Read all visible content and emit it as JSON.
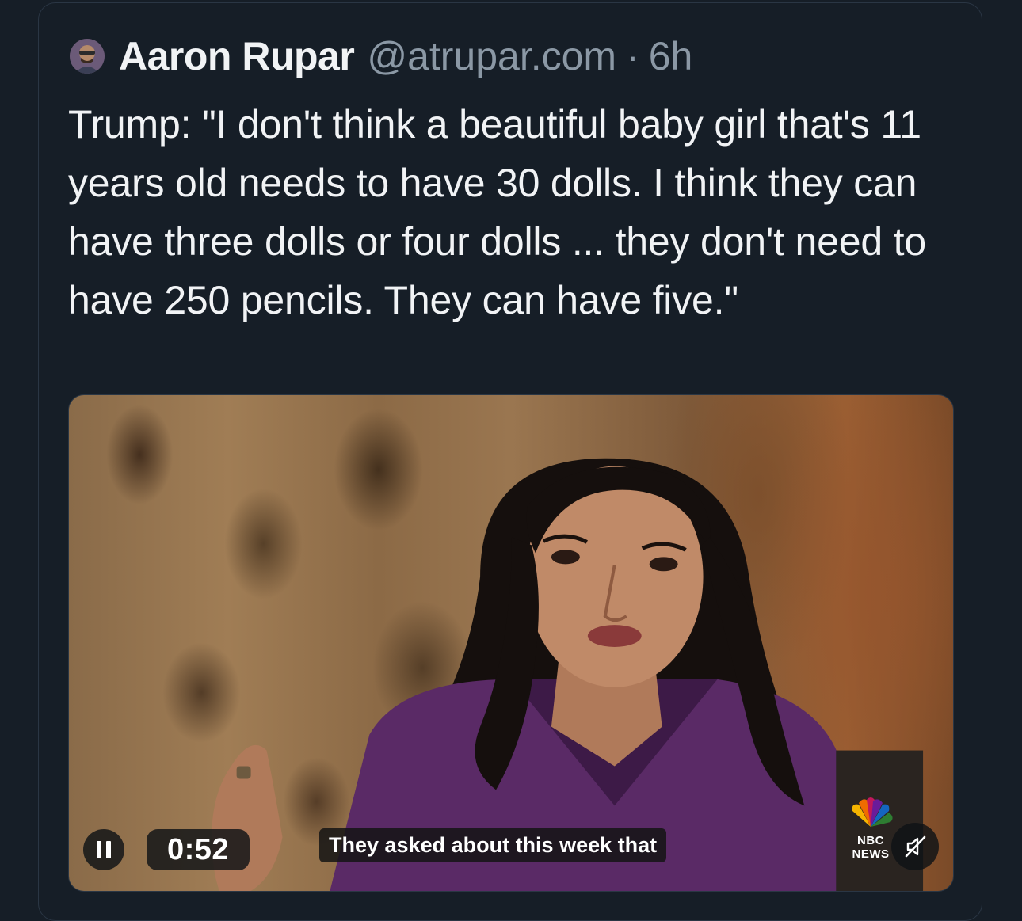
{
  "post": {
    "author_name": "Aaron Rupar",
    "handle": "@atrupar.com",
    "separator": "·",
    "timestamp": "6h",
    "text": "Trump: \"I don't think a beautiful baby girl that's 11 years old needs to have 30 dolls. I think they can have three dolls or four dolls ... they don't need to have 250 pencils. They can have five.\""
  },
  "video": {
    "elapsed": "0:52",
    "caption": "They asked about this week that",
    "logo_text": "NBC NEWS",
    "state": "playing",
    "muted": true
  },
  "colors": {
    "background": "#161e27",
    "text_primary": "#f1f3f5",
    "text_secondary": "#8b98a5"
  },
  "icons": {
    "play_state": "pause-icon",
    "sound": "mute-icon",
    "logo": "nbc-peacock-icon"
  }
}
